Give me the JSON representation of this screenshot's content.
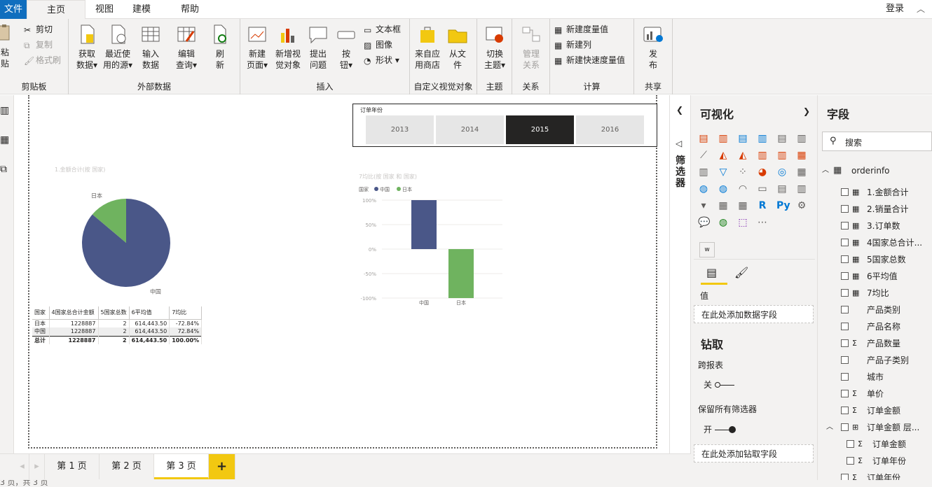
{
  "tabs": {
    "file": "文件",
    "home": "主页",
    "view": "视图",
    "model": "建模",
    "help": "帮助"
  },
  "login": "登录",
  "ribbon": {
    "clipboard": {
      "paste_1": "粘",
      "paste_2": "贴",
      "cut": "剪切",
      "copy": "复制",
      "format": "格式刷",
      "label": "剪贴板"
    },
    "external": {
      "get_data_1": "获取",
      "get_data_2": "数据",
      "recent_1": "最近使",
      "recent_2": "用的源",
      "enter_1": "输入",
      "enter_2": "数据",
      "edit_1": "编辑",
      "edit_2": "查询",
      "refresh_1": "刷",
      "refresh_2": "新",
      "label": "外部数据"
    },
    "insert": {
      "newpage_1": "新建",
      "newpage_2": "页面",
      "newvisual_1": "新增视",
      "newvisual_2": "觉对象",
      "ask_1": "提出",
      "ask_2": "问题",
      "button_1": "按",
      "button_2": "钮",
      "textbox": "文本框",
      "image": "图像",
      "shape": "形状",
      "label": "插入"
    },
    "custom": {
      "store_1": "来自应",
      "store_2": "用商店",
      "file_1": "从文",
      "file_2": "件",
      "label": "自定义视觉对象"
    },
    "theme": {
      "switch_1": "切换",
      "switch_2": "主题",
      "label": "主题"
    },
    "relations": {
      "manage_1": "管理",
      "manage_2": "关系",
      "label": "关系"
    },
    "calc": {
      "measure": "新建度量值",
      "column": "新建列",
      "quick": "新建快速度量值",
      "label": "计算"
    },
    "share": {
      "publish_1": "发",
      "publish_2": "布",
      "label": "共享"
    }
  },
  "filter_label": "筛选器",
  "viz": {
    "title": "可视化",
    "w_label": "w",
    "values_label": "值",
    "values_well": "在此处添加数据字段",
    "drill_title": "钻取",
    "cross_report": "跨报表",
    "off": "关",
    "keep_filters": "保留所有筛选器",
    "on": "开",
    "drill_well": "在此处添加钻取字段"
  },
  "fields": {
    "title": "字段",
    "search_placeholder": "搜索",
    "table": "orderinfo",
    "items": [
      {
        "label": "1.金额合计",
        "type": "calc"
      },
      {
        "label": "2.销量合计",
        "type": "calc"
      },
      {
        "label": "3.订单数",
        "type": "calc"
      },
      {
        "label": "4国家总合计...",
        "type": "calc"
      },
      {
        "label": "5国家总数",
        "type": "calc"
      },
      {
        "label": "6平均值",
        "type": "calc"
      },
      {
        "label": "7均比",
        "type": "calc"
      },
      {
        "label": "产品类别",
        "type": "text"
      },
      {
        "label": "产品名称",
        "type": "text"
      },
      {
        "label": "产品数量",
        "type": "sum"
      },
      {
        "label": "产品子类别",
        "type": "text"
      },
      {
        "label": "城市",
        "type": "text"
      },
      {
        "label": "单价",
        "type": "sum"
      },
      {
        "label": "订单金额",
        "type": "sum"
      },
      {
        "label": "订单金额 层...",
        "type": "hier"
      },
      {
        "label": "订单金额",
        "type": "sum",
        "indent": true
      },
      {
        "label": "订单年份",
        "type": "sum",
        "indent": true
      },
      {
        "label": "订单年份",
        "type": "sum"
      }
    ]
  },
  "pages": {
    "p1": "第 1 页",
    "p2": "第 2 页",
    "p3": "第 3 页",
    "add": "+"
  },
  "status": "3 页，共 3 页",
  "slicer": {
    "title": "订单年份",
    "years": [
      "2013",
      "2014",
      "2015",
      "2016"
    ],
    "selected": "2015"
  },
  "pie": {
    "title": "1.金额合计(按 国家)",
    "chart_data": {
      "type": "pie",
      "categories": [
        "中国",
        "日本"
      ],
      "values": [
        0.8614,
        0.1386
      ],
      "colors": [
        "#4a5788",
        "#6fb35f"
      ]
    }
  },
  "bar": {
    "title": "7均比(按 国家 和 国家)",
    "legend_label": "国家",
    "chart_data": {
      "type": "bar",
      "categories": [
        "中国",
        "日本"
      ],
      "values": [
        100,
        -100
      ],
      "colors": [
        "#4a5788",
        "#6fb35f"
      ],
      "yticks": [
        "100%",
        "50%",
        "0%",
        "-50%",
        "-100%"
      ],
      "ylim": [
        -100,
        100
      ]
    }
  },
  "table": {
    "headers": [
      "国家",
      "4国家总合计金额",
      "5国家总数",
      "6平均值",
      "7均比"
    ],
    "rows": [
      [
        "日本",
        "1228887",
        "2",
        "614,443.50",
        "-72.84%"
      ],
      [
        "中国",
        "1228887",
        "2",
        "614,443.50",
        "72.84%"
      ]
    ],
    "total": [
      "总计",
      "1228887",
      "2",
      "614,443.50",
      "100.00%"
    ]
  }
}
